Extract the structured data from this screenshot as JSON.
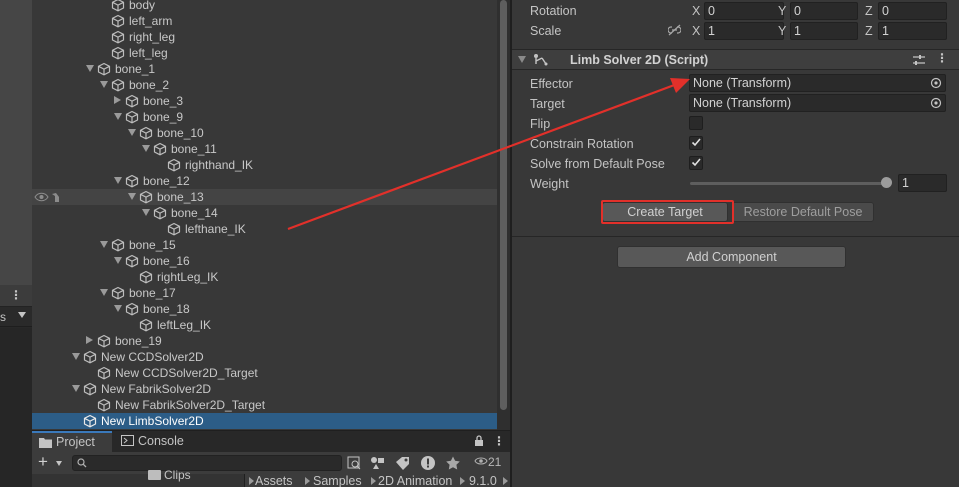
{
  "left_strip": {
    "more_icon": "⋮",
    "selector_text": "s"
  },
  "hierarchy": {
    "rows": [
      {
        "label": "body",
        "depth": 5,
        "fold": "none"
      },
      {
        "label": "left_arm",
        "depth": 5,
        "fold": "none"
      },
      {
        "label": "right_leg",
        "depth": 5,
        "fold": "none"
      },
      {
        "label": "left_leg",
        "depth": 5,
        "fold": "none"
      },
      {
        "label": "bone_1",
        "depth": 4,
        "fold": "open"
      },
      {
        "label": "bone_2",
        "depth": 5,
        "fold": "open"
      },
      {
        "label": "bone_3",
        "depth": 6,
        "fold": "closed"
      },
      {
        "label": "bone_9",
        "depth": 6,
        "fold": "open"
      },
      {
        "label": "bone_10",
        "depth": 7,
        "fold": "open"
      },
      {
        "label": "bone_11",
        "depth": 8,
        "fold": "open"
      },
      {
        "label": "righthand_IK",
        "depth": 9,
        "fold": "none"
      },
      {
        "label": "bone_12",
        "depth": 6,
        "fold": "open"
      },
      {
        "label": "bone_13",
        "depth": 7,
        "fold": "open",
        "state": "hover"
      },
      {
        "label": "bone_14",
        "depth": 8,
        "fold": "open"
      },
      {
        "label": "lefthane_IK",
        "depth": 9,
        "fold": "none"
      },
      {
        "label": "bone_15",
        "depth": 5,
        "fold": "open"
      },
      {
        "label": "bone_16",
        "depth": 6,
        "fold": "open"
      },
      {
        "label": "rightLeg_IK",
        "depth": 7,
        "fold": "none"
      },
      {
        "label": "bone_17",
        "depth": 5,
        "fold": "open"
      },
      {
        "label": "bone_18",
        "depth": 6,
        "fold": "open"
      },
      {
        "label": "leftLeg_IK",
        "depth": 7,
        "fold": "none"
      },
      {
        "label": "bone_19",
        "depth": 4,
        "fold": "closed"
      },
      {
        "label": "New CCDSolver2D",
        "depth": 3,
        "fold": "open"
      },
      {
        "label": "New CCDSolver2D_Target",
        "depth": 4,
        "fold": "none"
      },
      {
        "label": "New FabrikSolver2D",
        "depth": 3,
        "fold": "open"
      },
      {
        "label": "New FabrikSolver2D_Target",
        "depth": 4,
        "fold": "none"
      },
      {
        "label": "New LimbSolver2D",
        "depth": 3,
        "fold": "none",
        "state": "selected"
      }
    ]
  },
  "project_panel": {
    "tabs": [
      {
        "label": "Project",
        "icon": "folder-icon",
        "active": true
      },
      {
        "label": "Console",
        "icon": "console-icon",
        "active": false
      }
    ],
    "lock_icon": "🔒",
    "more_icon": "⋮",
    "add_label": "+",
    "badge_count": "21",
    "folder_item": "Clips",
    "breadcrumbs": [
      "Assets",
      "Samples",
      "2D Animation",
      "9.1.0"
    ]
  },
  "inspector": {
    "rotation": {
      "label": "Rotation",
      "x_axis": "X",
      "y_axis": "Y",
      "z_axis": "Z",
      "x": "0",
      "y": "0",
      "z": "0"
    },
    "scale": {
      "label": "Scale",
      "x_axis": "X",
      "y_axis": "Y",
      "z_axis": "Z",
      "x": "1",
      "y": "1",
      "z": "1"
    },
    "component": {
      "title": "Limb Solver 2D (Script)",
      "more_icon": "⋮"
    },
    "properties": {
      "effector": {
        "label": "Effector",
        "value": "None (Transform)"
      },
      "target": {
        "label": "Target",
        "value": "None (Transform)"
      },
      "flip": {
        "label": "Flip",
        "checked": false
      },
      "constrain_rotation": {
        "label": "Constrain Rotation",
        "checked": true
      },
      "solve_from_default_pose": {
        "label": "Solve from Default Pose",
        "checked": true
      },
      "weight": {
        "label": "Weight",
        "value": "1",
        "fraction": 1.0
      }
    },
    "buttons": {
      "create_target": "Create Target",
      "restore_default_pose": "Restore Default Pose",
      "add_component": "Add Component"
    }
  },
  "colors": {
    "selection": "#2c5d87",
    "highlight_annotation": "#e2302a",
    "panel_bg": "#383838"
  }
}
